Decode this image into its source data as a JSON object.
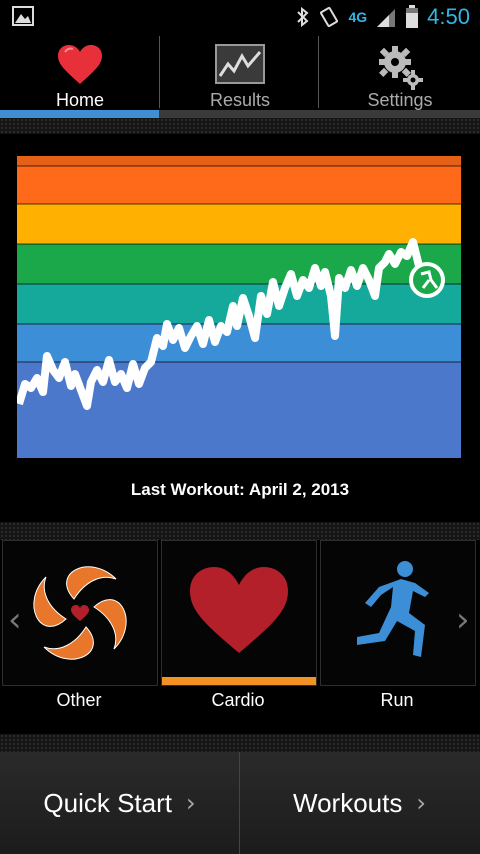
{
  "status_bar": {
    "time": "4:50",
    "network": "4G",
    "icons": [
      "image-icon",
      "bluetooth-icon",
      "rotation-icon",
      "signal-icon",
      "battery-icon"
    ],
    "clock_color": "#33b5e5"
  },
  "tabs": [
    {
      "label": "Home",
      "icon": "heart-icon",
      "active": true
    },
    {
      "label": "Results",
      "icon": "chart-icon",
      "active": false
    },
    {
      "label": "Settings",
      "icon": "gear-icon",
      "active": false
    }
  ],
  "chart": {
    "zones": [
      "#ff6a1a",
      "#ffb000",
      "#1aa84a",
      "#14a99a",
      "#3c8ed6",
      "#4c78cc"
    ],
    "last_workout_label": "Last Workout: April 2, 2013"
  },
  "activities": {
    "items": [
      {
        "label": "Other",
        "icon": "other-activity-icon",
        "selected": false
      },
      {
        "label": "Cardio",
        "icon": "heart-icon",
        "selected": true
      },
      {
        "label": "Run",
        "icon": "runner-icon",
        "selected": false
      }
    ],
    "accent": "#f39224"
  },
  "bottom_buttons": {
    "quick_start": "Quick Start",
    "workouts": "Workouts",
    "arrow": "›"
  }
}
